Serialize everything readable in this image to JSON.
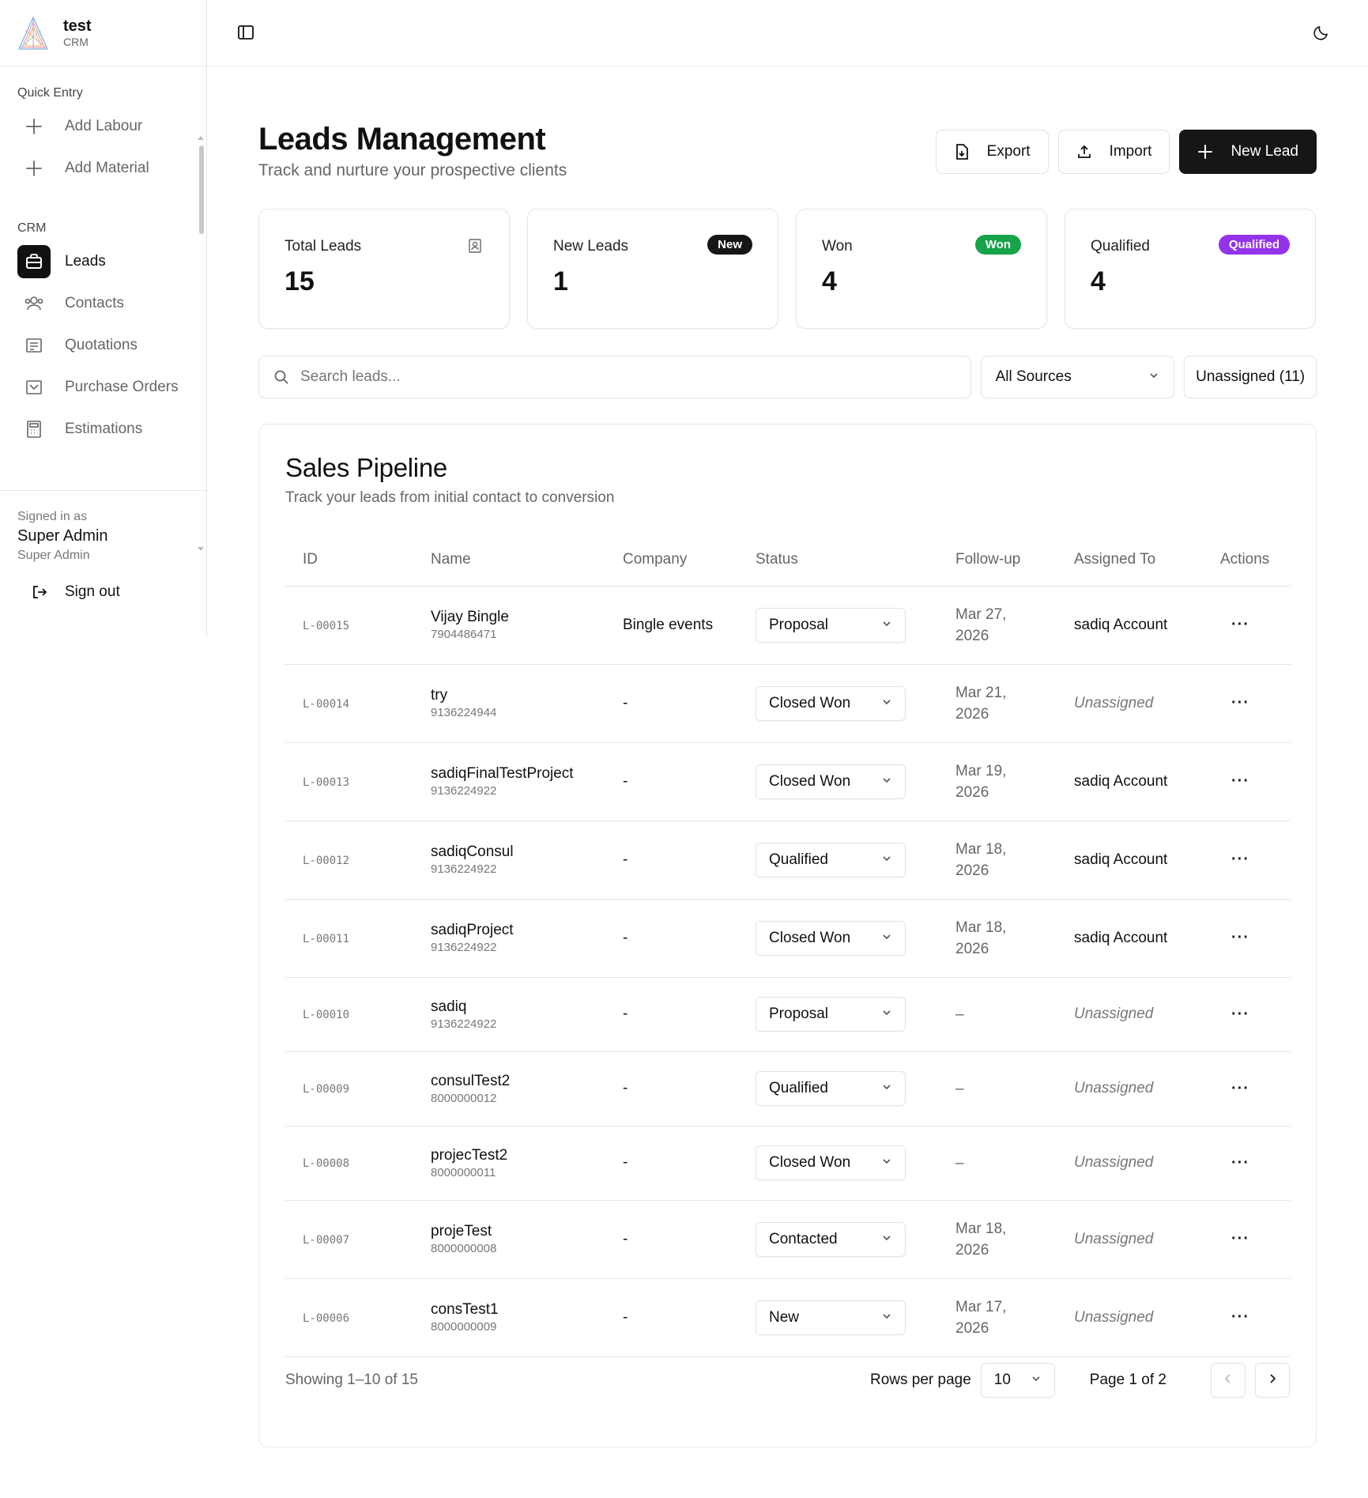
{
  "brand": {
    "name": "test",
    "sub": "CRM"
  },
  "sidebar": {
    "groups": [
      {
        "label": "Quick Entry",
        "items": [
          {
            "label": "Add Labour",
            "icon": "plus-icon"
          },
          {
            "label": "Add Material",
            "icon": "plus-icon"
          }
        ]
      },
      {
        "label": "CRM",
        "items": [
          {
            "label": "Leads",
            "icon": "briefcase-icon",
            "active": true
          },
          {
            "label": "Contacts",
            "icon": "users-icon"
          },
          {
            "label": "Quotations",
            "icon": "receipt-icon"
          },
          {
            "label": "Purchase Orders",
            "icon": "inbox-icon"
          },
          {
            "label": "Estimations",
            "icon": "calculator-icon"
          }
        ]
      }
    ],
    "user": {
      "signed_in_as": "Signed in as",
      "name": "Super Admin",
      "role": "Super Admin",
      "sign_out": "Sign out"
    }
  },
  "page": {
    "title": "Leads Management",
    "subtitle": "Track and nurture your prospective clients",
    "actions": {
      "export": "Export",
      "import": "Import",
      "new_lead": "New Lead"
    }
  },
  "stats": [
    {
      "label": "Total Leads",
      "value": "15",
      "icon": "contact-card-icon"
    },
    {
      "label": "New Leads",
      "value": "1",
      "badge": "New",
      "badge_color": "#161616"
    },
    {
      "label": "Won",
      "value": "4",
      "badge": "Won",
      "badge_color": "#16a34a"
    },
    {
      "label": "Qualified",
      "value": "4",
      "badge": "Qualified",
      "badge_color": "#9333ea"
    }
  ],
  "filters": {
    "search_placeholder": "Search leads...",
    "source": "All Sources",
    "unassigned": "Unassigned (11)"
  },
  "pipeline": {
    "title": "Sales Pipeline",
    "subtitle": "Track your leads from initial contact to conversion",
    "columns": [
      "ID",
      "Name",
      "Company",
      "Status",
      "Follow-up",
      "Assigned To",
      "Actions"
    ],
    "rows": [
      {
        "id": "L-00015",
        "name": "Vijay Bingle",
        "phone": "7904486471",
        "company": "Bingle events",
        "status": "Proposal",
        "followup_1": "Mar 27,",
        "followup_2": "2026",
        "assigned": "sadiq Account"
      },
      {
        "id": "L-00014",
        "name": "try",
        "phone": "9136224944",
        "company": "-",
        "status": "Closed Won",
        "followup_1": "Mar 21,",
        "followup_2": "2026",
        "assigned": "Unassigned"
      },
      {
        "id": "L-00013",
        "name": "sadiqFinalTestProject",
        "phone": "9136224922",
        "company": "-",
        "status": "Closed Won",
        "followup_1": "Mar 19,",
        "followup_2": "2026",
        "assigned": "sadiq Account"
      },
      {
        "id": "L-00012",
        "name": "sadiqConsul",
        "phone": "9136224922",
        "company": "-",
        "status": "Qualified",
        "followup_1": "Mar 18,",
        "followup_2": "2026",
        "assigned": "sadiq Account"
      },
      {
        "id": "L-00011",
        "name": "sadiqProject",
        "phone": "9136224922",
        "company": "-",
        "status": "Closed Won",
        "followup_1": "Mar 18,",
        "followup_2": "2026",
        "assigned": "sadiq Account"
      },
      {
        "id": "L-00010",
        "name": "sadiq",
        "phone": "9136224922",
        "company": "-",
        "status": "Proposal",
        "followup_1": "–",
        "followup_2": "",
        "assigned": "Unassigned"
      },
      {
        "id": "L-00009",
        "name": "consulTest2",
        "phone": "8000000012",
        "company": "-",
        "status": "Qualified",
        "followup_1": "–",
        "followup_2": "",
        "assigned": "Unassigned"
      },
      {
        "id": "L-00008",
        "name": "projecTest2",
        "phone": "8000000011",
        "company": "-",
        "status": "Closed Won",
        "followup_1": "–",
        "followup_2": "",
        "assigned": "Unassigned"
      },
      {
        "id": "L-00007",
        "name": "projeTest",
        "phone": "8000000008",
        "company": "-",
        "status": "Contacted",
        "followup_1": "Mar 18,",
        "followup_2": "2026",
        "assigned": "Unassigned"
      },
      {
        "id": "L-00006",
        "name": "consTest1",
        "phone": "8000000009",
        "company": "-",
        "status": "New",
        "followup_1": "Mar 17,",
        "followup_2": "2026",
        "assigned": "Unassigned"
      }
    ]
  },
  "pagination": {
    "showing": "Showing 1–10 of 15",
    "rows_per_page_label": "Rows per page",
    "rows_per_page": "10",
    "page_info": "Page 1 of 2"
  }
}
